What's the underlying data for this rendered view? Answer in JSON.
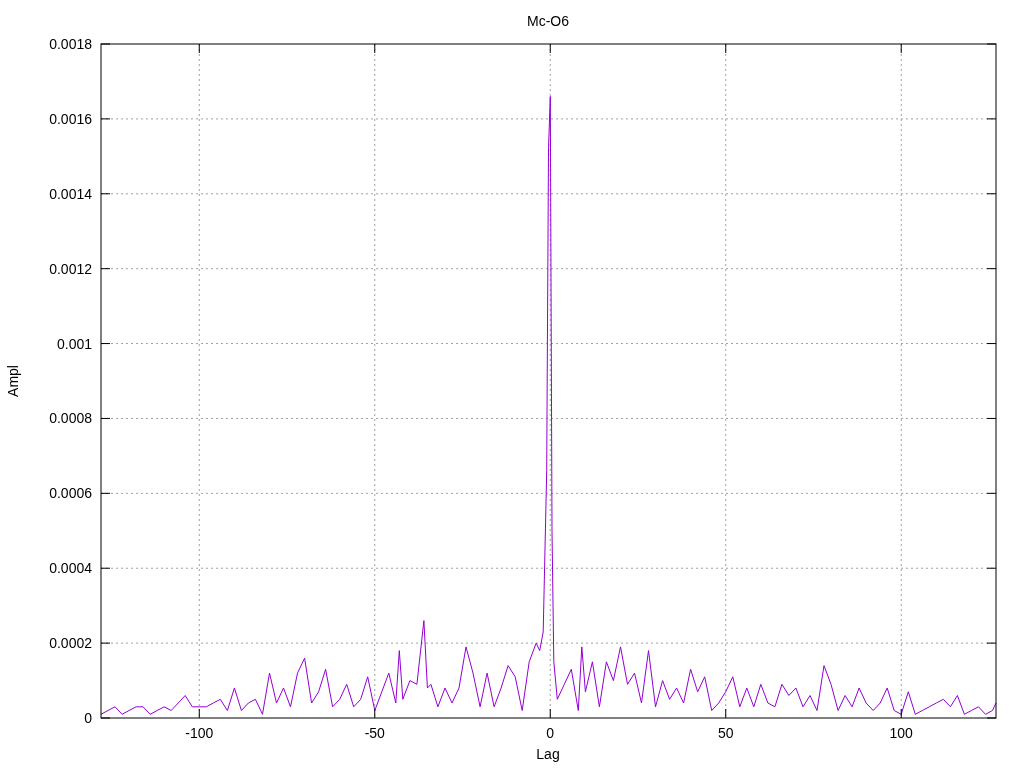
{
  "chart_data": {
    "type": "line",
    "title": "Mc-O6",
    "xlabel": "Lag",
    "ylabel": "Ampl",
    "xlim": [
      -128,
      127
    ],
    "grid": true,
    "ylim": [
      0,
      0.0018
    ],
    "xticks": [
      -100,
      -50,
      0,
      50,
      100
    ],
    "yticks": [
      0,
      0.0002,
      0.0004,
      0.0006,
      0.0008,
      0.001,
      0.0012,
      0.0014,
      0.0016,
      0.0018
    ],
    "x": [
      -128,
      -126,
      -124,
      -122,
      -120,
      -118,
      -116,
      -114,
      -112,
      -110,
      -108,
      -106,
      -104,
      -102,
      -100,
      -98,
      -96,
      -94,
      -92,
      -90,
      -88,
      -86,
      -84,
      -82,
      -80,
      -78,
      -76,
      -74,
      -72,
      -70,
      -68,
      -66,
      -64,
      -62,
      -60,
      -58,
      -56,
      -54,
      -52,
      -50,
      -48,
      -46,
      -44,
      -43,
      -42,
      -40,
      -38,
      -36,
      -35,
      -34,
      -32,
      -30,
      -28,
      -26,
      -24,
      -22,
      -20,
      -18,
      -16,
      -14,
      -12,
      -10,
      -8,
      -6,
      -4,
      -3,
      -2,
      -1,
      -0.5,
      0,
      0.5,
      1,
      2,
      4,
      6,
      8,
      9,
      10,
      12,
      14,
      16,
      18,
      20,
      22,
      24,
      26,
      28,
      30,
      32,
      34,
      36,
      38,
      40,
      42,
      44,
      46,
      48,
      50,
      52,
      54,
      56,
      58,
      60,
      62,
      64,
      66,
      68,
      70,
      72,
      74,
      75,
      76,
      78,
      80,
      82,
      84,
      86,
      88,
      90,
      92,
      94,
      96,
      98,
      100,
      102,
      104,
      106,
      108,
      110,
      112,
      114,
      116,
      118,
      120,
      122,
      124,
      126,
      127
    ],
    "series": [
      {
        "color": "#9400d3",
        "values": [
          1e-05,
          2e-05,
          3e-05,
          1e-05,
          2e-05,
          3e-05,
          3e-05,
          1e-05,
          2e-05,
          3e-05,
          2e-05,
          4e-05,
          6e-05,
          3e-05,
          3e-05,
          3e-05,
          4e-05,
          5e-05,
          2e-05,
          8e-05,
          2e-05,
          4e-05,
          5e-05,
          1e-05,
          0.00012,
          4e-05,
          8e-05,
          3e-05,
          0.00012,
          0.00016,
          4e-05,
          7e-05,
          0.00013,
          3e-05,
          5e-05,
          9e-05,
          3e-05,
          5e-05,
          0.00011,
          2e-05,
          7e-05,
          0.00012,
          4e-05,
          0.00018,
          5e-05,
          0.0001,
          9e-05,
          0.00026,
          8e-05,
          9e-05,
          3e-05,
          8e-05,
          4e-05,
          8e-05,
          0.00019,
          0.00012,
          3e-05,
          0.00012,
          3e-05,
          8e-05,
          0.00014,
          0.00011,
          2e-05,
          0.00015,
          0.0002,
          0.00018,
          0.00023,
          0.00066,
          0.00152,
          0.00166,
          0.0005,
          0.00015,
          5e-05,
          9e-05,
          0.00013,
          2e-05,
          0.00019,
          7e-05,
          0.00015,
          3e-05,
          0.00015,
          0.0001,
          0.00019,
          9e-05,
          0.00012,
          4e-05,
          0.00018,
          3e-05,
          0.0001,
          5e-05,
          8e-05,
          4e-05,
          0.00013,
          7e-05,
          0.00011,
          2e-05,
          4e-05,
          7e-05,
          0.00011,
          3e-05,
          8e-05,
          3e-05,
          9e-05,
          4e-05,
          3e-05,
          9e-05,
          6e-05,
          8e-05,
          3e-05,
          6e-05,
          4e-05,
          2e-05,
          0.00014,
          9e-05,
          2e-05,
          6e-05,
          3e-05,
          8e-05,
          4e-05,
          2e-05,
          4e-05,
          8e-05,
          2e-05,
          1e-05,
          7e-05,
          1e-05,
          2e-05,
          3e-05,
          4e-05,
          5e-05,
          3e-05,
          6e-05,
          1e-05,
          2e-05,
          3e-05,
          1e-05,
          2e-05,
          4e-05
        ]
      }
    ]
  }
}
